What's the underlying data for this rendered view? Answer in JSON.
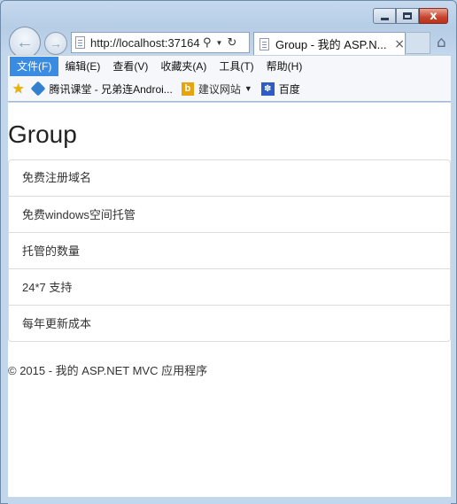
{
  "browser": {
    "address_url": "http://localhost:37164",
    "tab_title": "Group - 我的 ASP.N...",
    "tab_close": "×",
    "nav_back": "←",
    "nav_forward": "→",
    "caption_close": "x"
  },
  "menubar": {
    "items": [
      "文件(F)",
      "编辑(E)",
      "查看(V)",
      "收藏夹(A)",
      "工具(T)",
      "帮助(H)"
    ]
  },
  "favorites": {
    "items": [
      "腾讯课堂 - 兄弟连Androi...",
      "建议网站",
      "百度"
    ]
  },
  "page": {
    "title": "Group",
    "list_items": [
      "免费注册域名",
      "免费windows空间托管",
      "托管的数量",
      "24*7 支持",
      "每年更新成本"
    ],
    "footer": "© 2015 - 我的 ASP.NET MVC 应用程序"
  },
  "colors": {
    "menu_active": "#3a8be2",
    "close_button": "#c8432c",
    "frame": "#c5d9ee"
  },
  "icons": {
    "back": "back-arrow-icon",
    "forward": "forward-arrow-icon",
    "page": "page-icon",
    "search": "search-icon",
    "refresh": "refresh-icon",
    "home": "home-icon",
    "favorites": "favorites-star-icon"
  }
}
